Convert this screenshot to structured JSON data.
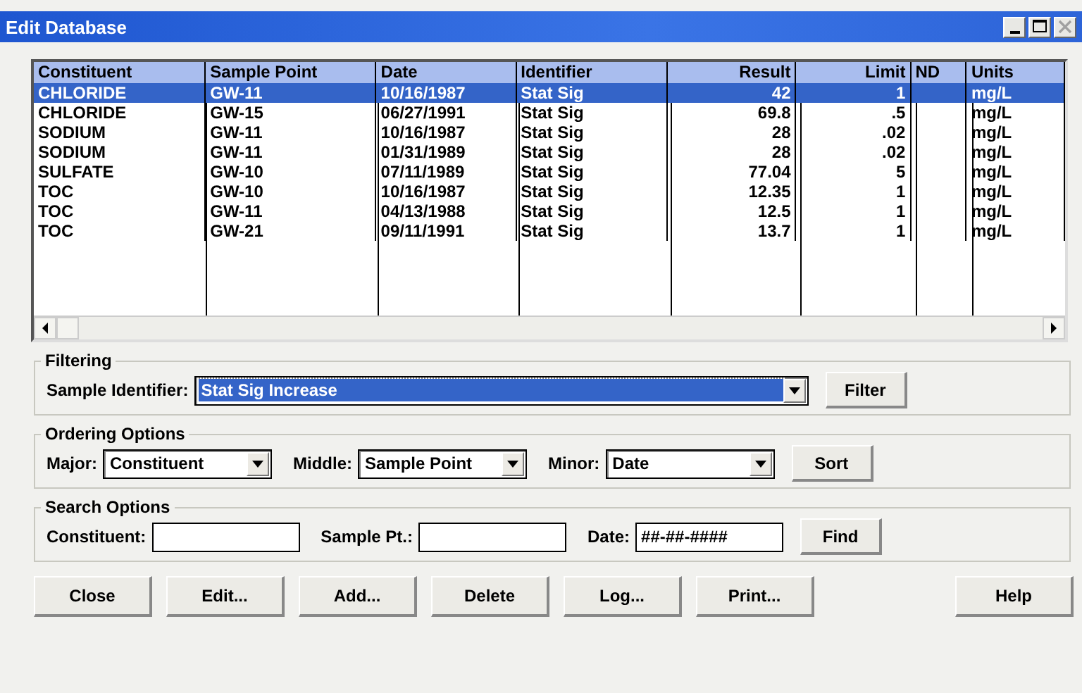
{
  "window": {
    "title": "Edit Database",
    "close_disabled": true
  },
  "table": {
    "columns": [
      "Constituent",
      "Sample Point",
      "Date",
      "Identifier",
      "Result",
      "Limit",
      "ND",
      "Units"
    ],
    "rows": [
      {
        "cells": [
          "CHLORIDE",
          "GW-11",
          "10/16/1987",
          "Stat Sig",
          "42",
          "1",
          "",
          "mg/L"
        ],
        "selected": true
      },
      {
        "cells": [
          "CHLORIDE",
          "GW-15",
          "06/27/1991",
          "Stat Sig",
          "69.8",
          ".5",
          "",
          "mg/L"
        ],
        "selected": false
      },
      {
        "cells": [
          "SODIUM",
          "GW-11",
          "10/16/1987",
          "Stat Sig",
          "28",
          ".02",
          "",
          "mg/L"
        ],
        "selected": false
      },
      {
        "cells": [
          "SODIUM",
          "GW-11",
          "01/31/1989",
          "Stat Sig",
          "28",
          ".02",
          "",
          "mg/L"
        ],
        "selected": false
      },
      {
        "cells": [
          "SULFATE",
          "GW-10",
          "07/11/1989",
          "Stat Sig",
          "77.04",
          "5",
          "",
          "mg/L"
        ],
        "selected": false
      },
      {
        "cells": [
          "TOC",
          "GW-10",
          "10/16/1987",
          "Stat Sig",
          "12.35",
          "1",
          "",
          "mg/L"
        ],
        "selected": false
      },
      {
        "cells": [
          "TOC",
          "GW-11",
          "04/13/1988",
          "Stat Sig",
          "12.5",
          "1",
          "",
          "mg/L"
        ],
        "selected": false
      },
      {
        "cells": [
          "TOC",
          "GW-21",
          "09/11/1991",
          "Stat Sig",
          "13.7",
          "1",
          "",
          "mg/L"
        ],
        "selected": false
      }
    ]
  },
  "filtering": {
    "title": "Filtering",
    "label": "Sample Identifier:",
    "value": "Stat Sig Increase",
    "highlighted": true,
    "button": "Filter"
  },
  "ordering": {
    "title": "Ordering Options",
    "fields": [
      {
        "label": "Major:",
        "value": "Constituent"
      },
      {
        "label": "Middle:",
        "value": "Sample Point"
      },
      {
        "label": "Minor:",
        "value": "Date"
      }
    ],
    "button": "Sort"
  },
  "search": {
    "title": "Search Options",
    "fields": [
      {
        "label": "Constituent:"
      },
      {
        "label": "Sample Pt.:"
      },
      {
        "label": "Date:",
        "value": "##-##-####"
      }
    ],
    "button": "Find"
  },
  "buttons": [
    "Close",
    "Edit...",
    "Add...",
    "Delete",
    "Log...",
    "Print...",
    "Help"
  ]
}
